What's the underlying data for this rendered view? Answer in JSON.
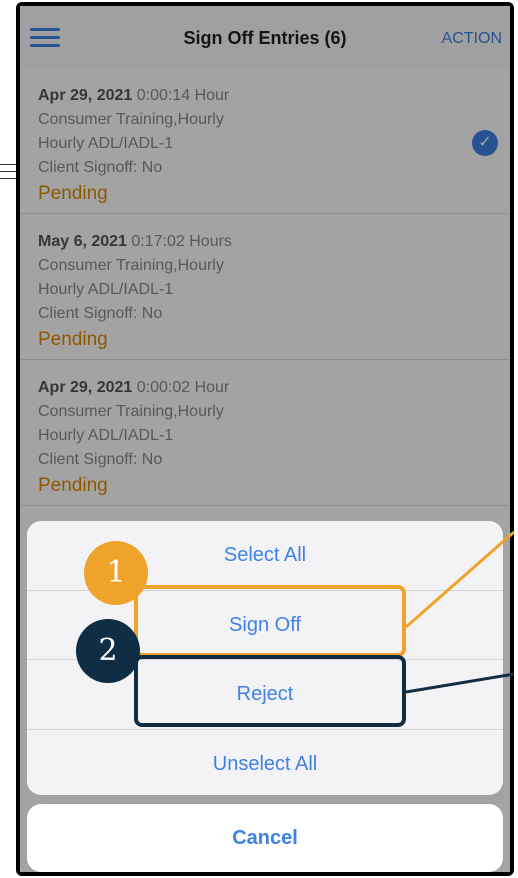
{
  "navbar": {
    "title": "Sign Off Entries (6)",
    "action_label": "ACTION"
  },
  "entries": [
    {
      "date": "Apr 29, 2021",
      "duration": "0:00:14 Hour",
      "service": "Consumer Training,Hourly",
      "code": "Hourly ADL/IADL-1",
      "client_signoff": "Client Signoff: No",
      "status": "Pending",
      "selected": true
    },
    {
      "date": "May 6, 2021",
      "duration": "0:17:02 Hours",
      "service": "Consumer Training,Hourly",
      "code": "Hourly ADL/IADL-1",
      "client_signoff": "Client Signoff: No",
      "status": "Pending",
      "selected": false
    },
    {
      "date": "Apr 29, 2021",
      "duration": "0:00:02 Hour",
      "service": "Consumer Training,Hourly",
      "code": "Hourly ADL/IADL-1",
      "client_signoff": "Client Signoff: No",
      "status": "Pending",
      "selected": false
    }
  ],
  "action_sheet": {
    "select_all": "Select All",
    "sign_off": "Sign Off",
    "reject": "Reject",
    "unselect_all": "Unselect All",
    "cancel": "Cancel"
  },
  "callouts": {
    "badge_1": "1",
    "badge_2": "2"
  },
  "colors": {
    "accent_blue": "#3f82e6",
    "pending_orange": "#e08a00",
    "callout_orange": "#f0a32b",
    "callout_navy": "#0f2d44"
  },
  "icons": {
    "menu": "hamburger-icon",
    "selected": "checkmark-icon"
  }
}
